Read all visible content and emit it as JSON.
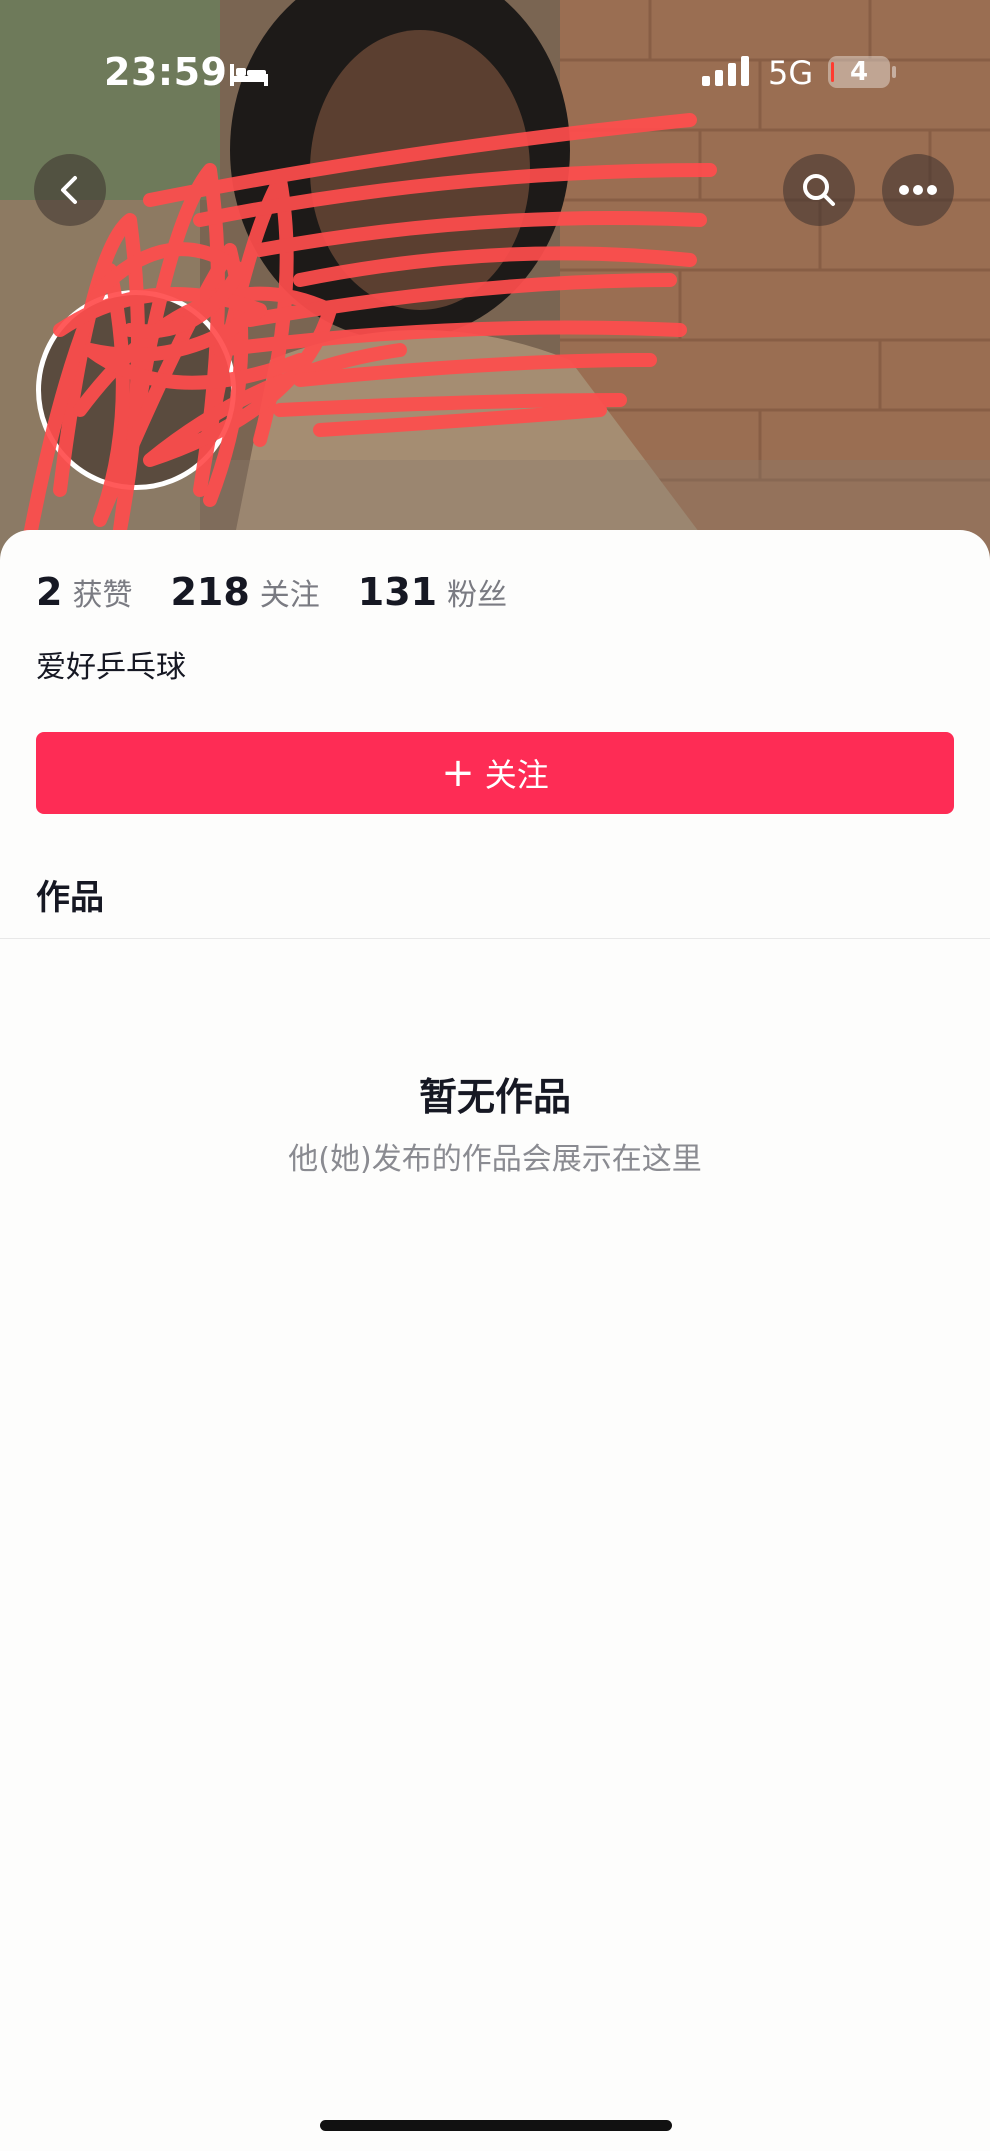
{
  "status_bar": {
    "time": "23:59",
    "network": "5G",
    "battery": "4"
  },
  "header": {
    "icons": [
      "back-icon",
      "search-icon",
      "more-icon"
    ]
  },
  "profile": {
    "stats": [
      {
        "value": "2",
        "label": "获赞"
      },
      {
        "value": "218",
        "label": "关注"
      },
      {
        "value": "131",
        "label": "粉丝"
      }
    ],
    "bio": "爱好乒乓球"
  },
  "actions": {
    "follow_plus": "+",
    "follow_label": "关注"
  },
  "tabs": {
    "works": "作品"
  },
  "empty_state": {
    "title": "暂无作品",
    "subtitle": "他(她)发布的作品会展示在这里"
  },
  "colors": {
    "accent": "#fe2c55",
    "scribble": "#ff4d4d"
  }
}
